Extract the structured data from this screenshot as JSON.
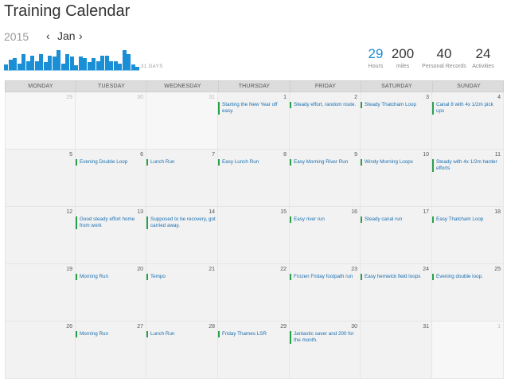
{
  "header": {
    "title": "Training Calendar"
  },
  "nav": {
    "year": "2015",
    "month": "Jan",
    "prev": "‹",
    "next": "›"
  },
  "sparkline": {
    "label": "31 DAYS",
    "values": [
      0.25,
      0.45,
      0.55,
      0.3,
      0.7,
      0.4,
      0.65,
      0.4,
      0.7,
      0.35,
      0.65,
      0.6,
      0.9,
      0.3,
      0.7,
      0.6,
      0.2,
      0.6,
      0.55,
      0.35,
      0.55,
      0.4,
      0.65,
      0.65,
      0.4,
      0.4,
      0.3,
      0.9,
      0.7,
      0.25,
      0.15
    ]
  },
  "stats": [
    {
      "value": "29",
      "label": "Hours"
    },
    {
      "value": "200",
      "label": "miles"
    },
    {
      "value": "40",
      "label": "Personal Records"
    },
    {
      "value": "24",
      "label": "Activities"
    }
  ],
  "weekdays": [
    "MONDAY",
    "TUESDAY",
    "WEDNESDAY",
    "THURSDAY",
    "FRIDAY",
    "SATURDAY",
    "SUNDAY"
  ],
  "weeks": [
    [
      {
        "day": "29",
        "outside": true,
        "activity": ""
      },
      {
        "day": "30",
        "outside": true,
        "activity": ""
      },
      {
        "day": "31",
        "outside": true,
        "activity": ""
      },
      {
        "day": "1",
        "outside": false,
        "activity": "Starting the New Year off easy."
      },
      {
        "day": "2",
        "outside": false,
        "activity": "Steady effort, random route."
      },
      {
        "day": "3",
        "outside": false,
        "activity": "Steady Thatcham Loop"
      },
      {
        "day": "4",
        "outside": false,
        "activity": "Canal 8 with 4x 1/2m pick ups"
      }
    ],
    [
      {
        "day": "5",
        "outside": false,
        "activity": ""
      },
      {
        "day": "6",
        "outside": false,
        "activity": "Evening Double Loop"
      },
      {
        "day": "7",
        "outside": false,
        "activity": "Lunch Run"
      },
      {
        "day": "8",
        "outside": false,
        "activity": "Easy Lunch Run"
      },
      {
        "day": "9",
        "outside": false,
        "activity": "Easy Morning River Run"
      },
      {
        "day": "10",
        "outside": false,
        "activity": "Windy Morning Loops"
      },
      {
        "day": "11",
        "outside": false,
        "activity": "Steady with 4x 1/2m harder efforts"
      }
    ],
    [
      {
        "day": "12",
        "outside": false,
        "activity": ""
      },
      {
        "day": "13",
        "outside": false,
        "activity": "Good steady effort home from work"
      },
      {
        "day": "14",
        "outside": false,
        "activity": "Supposed to be recovery, got carried away."
      },
      {
        "day": "15",
        "outside": false,
        "activity": ""
      },
      {
        "day": "16",
        "outside": false,
        "activity": "Easy river run"
      },
      {
        "day": "17",
        "outside": false,
        "activity": "Steady canal run"
      },
      {
        "day": "18",
        "outside": false,
        "activity": "Easy Thatcham Loop"
      }
    ],
    [
      {
        "day": "19",
        "outside": false,
        "activity": ""
      },
      {
        "day": "20",
        "outside": false,
        "activity": "Morning Run"
      },
      {
        "day": "21",
        "outside": false,
        "activity": "Tempo"
      },
      {
        "day": "22",
        "outside": false,
        "activity": ""
      },
      {
        "day": "23",
        "outside": false,
        "activity": "Frozen Friday footpath run"
      },
      {
        "day": "24",
        "outside": false,
        "activity": "Easy hemwick field loops"
      },
      {
        "day": "25",
        "outside": false,
        "activity": "Evening double loop."
      }
    ],
    [
      {
        "day": "26",
        "outside": false,
        "activity": ""
      },
      {
        "day": "27",
        "outside": false,
        "activity": "Morning Run"
      },
      {
        "day": "28",
        "outside": false,
        "activity": "Lunch Run"
      },
      {
        "day": "29",
        "outside": false,
        "activity": "Friday Thames LSR"
      },
      {
        "day": "30",
        "outside": false,
        "activity": "Jantastic saver and 200 for the month."
      },
      {
        "day": "31",
        "outside": false,
        "activity": ""
      },
      {
        "day": "1",
        "outside": true,
        "activity": ""
      }
    ]
  ],
  "colors": {
    "accent": "#1a8fd6",
    "activity_marker": "#2aa04a",
    "link": "#1a6fb0"
  }
}
